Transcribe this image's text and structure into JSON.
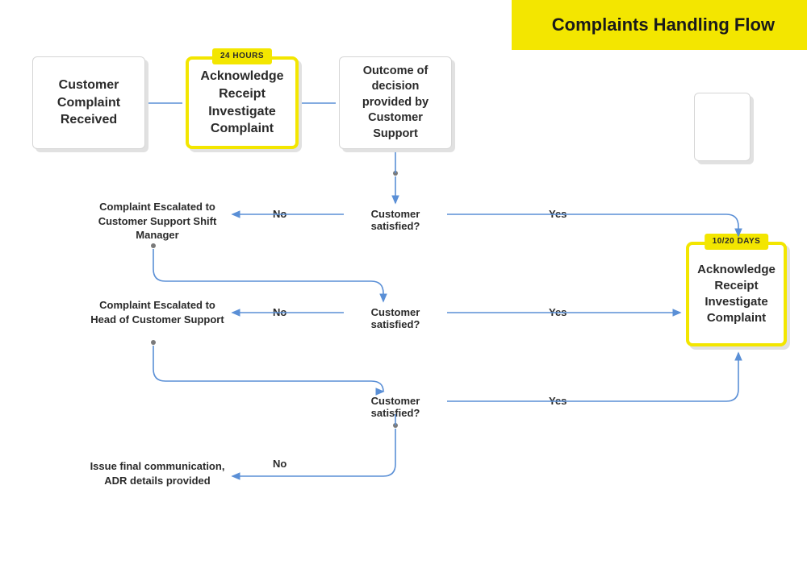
{
  "title": "Complaints Handling Flow",
  "nodes": {
    "received": {
      "text": "Customer Complaint Received"
    },
    "ack": {
      "text": "Acknowledge Receipt Investigate Complaint",
      "tag": "24 HOURS"
    },
    "outcome": {
      "text": "Outcome of decision provided by Customer Support"
    },
    "resolve": {
      "text": "Acknowledge Receipt Investigate Complaint",
      "tag": "10/20 DAYS"
    }
  },
  "decisions": {
    "d1": "Customer satisfied?",
    "d2": "Customer satisfied?",
    "d3": "Customer satisfied?"
  },
  "outcomes": {
    "o1": "Complaint Escalated to Customer Support Shift Manager",
    "o2": "Complaint Escalated to Head of Customer Support",
    "o3": "Issue final communication, ADR details provided"
  },
  "labels": {
    "yes": "Yes",
    "no": "No"
  }
}
